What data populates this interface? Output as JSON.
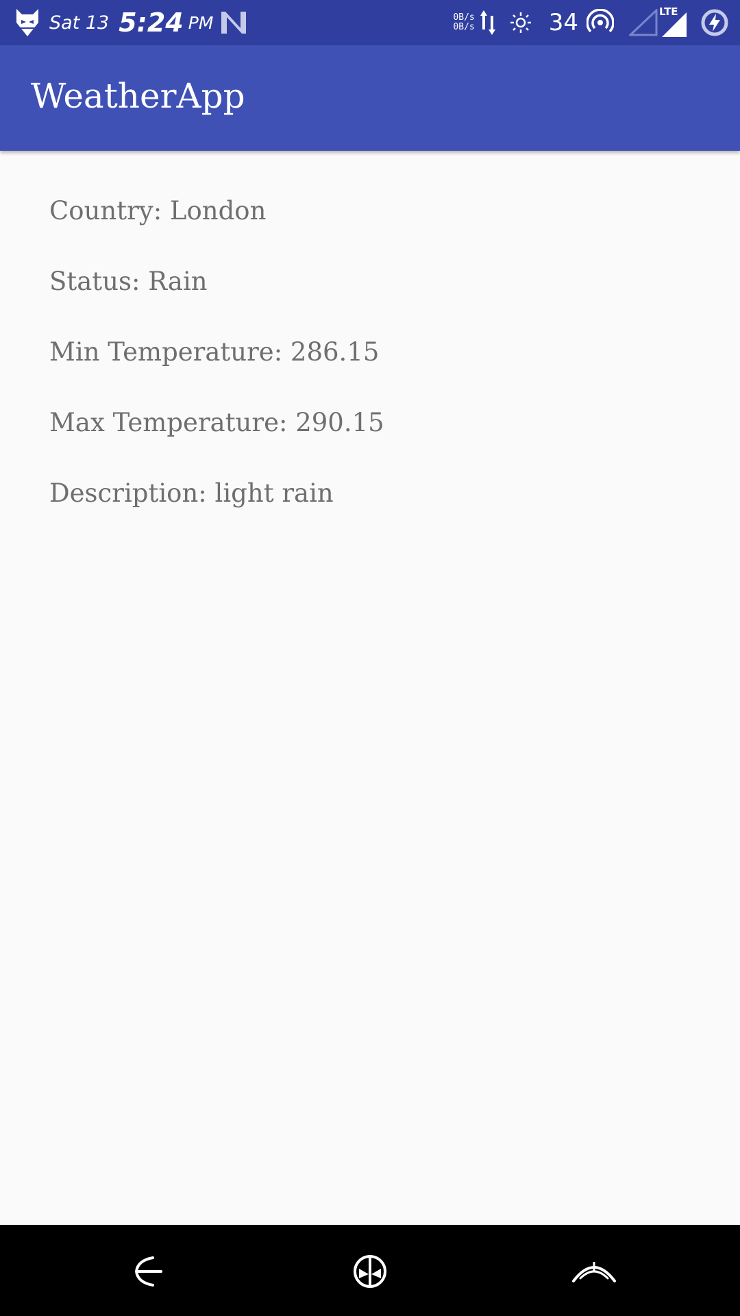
{
  "status_bar": {
    "day": "Sat 13",
    "time": "5:24",
    "ampm": "PM",
    "speed_up": "0B/s",
    "speed_down": "0B/s",
    "battery_percent": "34",
    "network_label": "LTE"
  },
  "app_bar": {
    "title": "WeatherApp"
  },
  "weather": {
    "country": "Country: London",
    "status": "Status: Rain",
    "min_temp": "Min Temperature: 286.15",
    "max_temp": "Max Temperature: 290.15",
    "description": "Description: light rain"
  },
  "nav_bar": {
    "icons": [
      "back-icon",
      "home-icon",
      "recents-icon"
    ]
  },
  "colors": {
    "status_bar": "#303f9f",
    "app_bar": "#3f51b5",
    "background": "#fafafa",
    "text": "#6f6f6f"
  }
}
